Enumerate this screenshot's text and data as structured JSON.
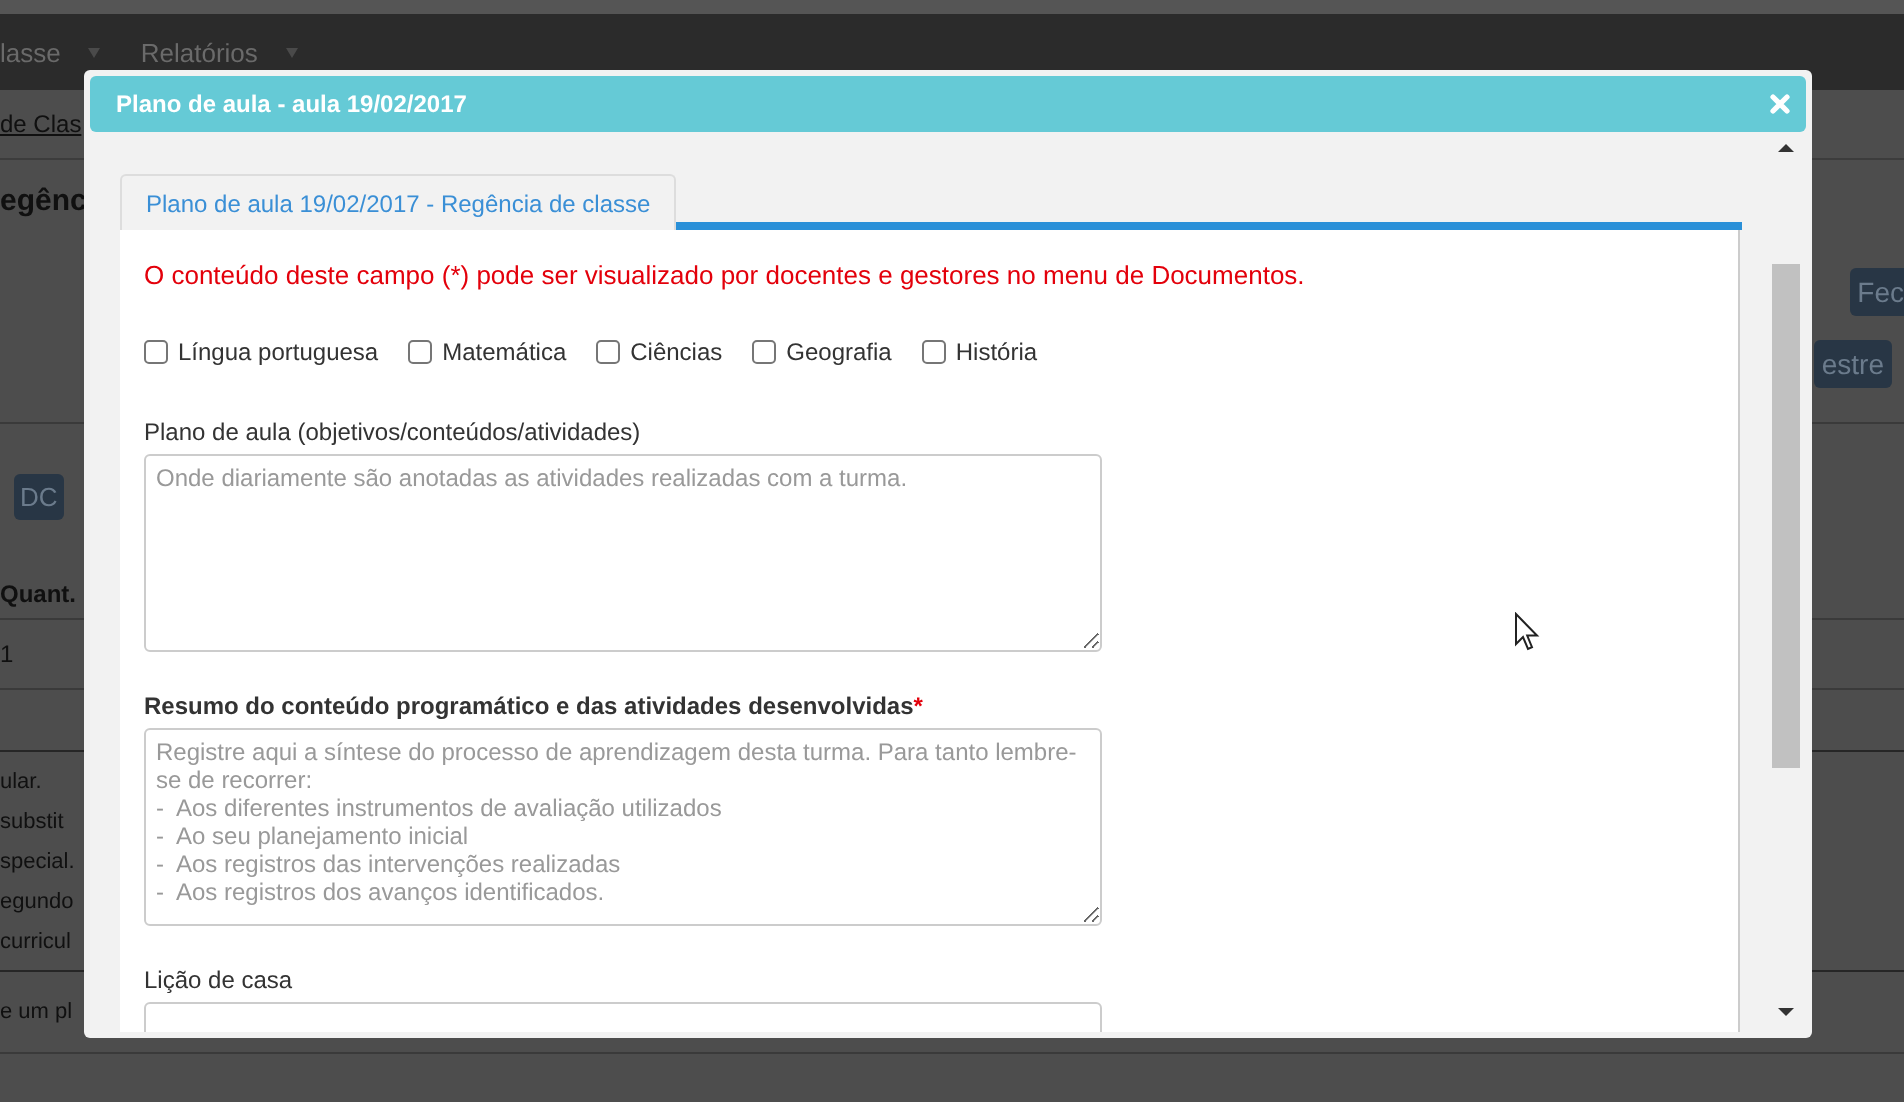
{
  "background_page": {
    "nav_items": [
      {
        "label": "lasse"
      },
      {
        "label": "Relatórios"
      }
    ],
    "breadcrumb": "de Clas",
    "heading": "egênc",
    "buttons_right": [
      "Fec",
      "estre"
    ],
    "button_left": "DC",
    "table": {
      "columns": [
        "Quant."
      ],
      "rows": [
        [
          "1"
        ]
      ]
    },
    "notes": [
      "ular.",
      "substit",
      "special.",
      "egundo",
      "curricul"
    ],
    "footer_text": "e um pl"
  },
  "dialog": {
    "title": "Plano de aula - aula 19/02/2017",
    "tabs": [
      {
        "label": "Plano de aula 19/02/2017 - Regência de classe",
        "selected": true
      }
    ],
    "notice": "O conteúdo deste campo (*) pode ser visualizado por docentes e gestores no menu de Documentos.",
    "subjects": [
      {
        "label": "Língua portuguesa",
        "checked": false
      },
      {
        "label": "Matemática",
        "checked": false
      },
      {
        "label": "Ciências",
        "checked": false
      },
      {
        "label": "Geografia",
        "checked": false
      },
      {
        "label": "História",
        "checked": false
      }
    ],
    "fields": [
      {
        "label": "Plano de aula (objetivos/conteúdos/atividades)",
        "required": false,
        "placeholder": "Onde diariamente são anotadas as atividades realizadas com a turma."
      },
      {
        "label": "Resumo do conteúdo programático e das atividades desenvolvidas",
        "required": true,
        "required_mark": "*",
        "placeholder": "Registre aqui a síntese do processo de aprendizagem desta turma. Para tanto lembre-se de recorrer:\n-  Aos diferentes instrumentos de avaliação utilizados\n-  Ao seu planejamento inicial\n-  Aos registros das intervenções realizadas\n-  Aos registros dos avanços identificados."
      },
      {
        "label": "Lição de casa",
        "required": false
      }
    ]
  }
}
